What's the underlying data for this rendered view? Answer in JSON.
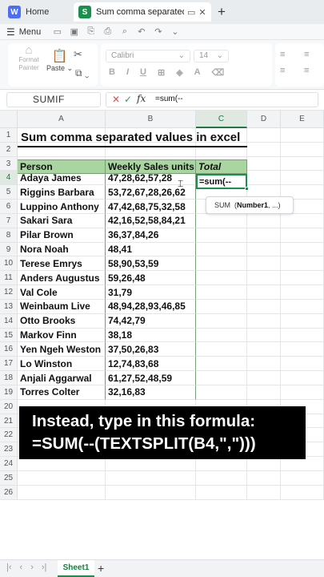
{
  "tabs": {
    "home": "Home",
    "doc": "Sum comma separated values",
    "doc_icon": "S",
    "home_icon": "W",
    "new_tab": "+"
  },
  "menu": {
    "label": "Menu"
  },
  "ribbon": {
    "format_painter": "Format Painter",
    "paste": "Paste",
    "font": "Calibri",
    "size": "14",
    "bold": "B",
    "italic": "I",
    "underline": "U"
  },
  "formula_bar": {
    "name_box": "SUMIF",
    "fx": "fx",
    "formula": "=sum(--"
  },
  "columns": [
    "A",
    "B",
    "C",
    "D",
    "E"
  ],
  "rows": [
    "1",
    "2",
    "3",
    "4",
    "5",
    "6",
    "7",
    "8",
    "9",
    "10",
    "11",
    "12",
    "13",
    "14",
    "15",
    "16",
    "17",
    "18",
    "19",
    "20",
    "21",
    "22",
    "23",
    "24",
    "25",
    "26"
  ],
  "sheet": {
    "title": "Sum comma separated values in excel",
    "headers": {
      "person": "Person",
      "sales": "Weekly Sales units",
      "total": "Total"
    },
    "data": [
      {
        "person": "Adaya James",
        "sales": "47,28,62,57,28"
      },
      {
        "person": "Riggins Barbara",
        "sales": "53,72,67,28,26,62"
      },
      {
        "person": "Luppino Anthony",
        "sales": "47,42,68,75,32,58"
      },
      {
        "person": "Sakari Sara",
        "sales": "42,16,52,58,84,21"
      },
      {
        "person": "Pilar Brown",
        "sales": "36,37,84,26"
      },
      {
        "person": "Nora Noah",
        "sales": "48,41"
      },
      {
        "person": "Terese Emrys",
        "sales": "58,90,53,59"
      },
      {
        "person": "Anders Augustus",
        "sales": "59,26,48"
      },
      {
        "person": "Val Cole",
        "sales": "31,79"
      },
      {
        "person": "Weinbaum Live",
        "sales": "48,94,28,93,46,85"
      },
      {
        "person": "Otto Brooks",
        "sales": "74,42,79"
      },
      {
        "person": "Markov Finn",
        "sales": "38,18"
      },
      {
        "person": "Yen Ngeh Weston",
        "sales": "37,50,26,83"
      },
      {
        "person": "Lo Winston",
        "sales": "12,74,83,68"
      },
      {
        "person": "Anjali Aggarwal",
        "sales": "61,27,52,48,59"
      },
      {
        "person": "Torres Colter",
        "sales": "32,16,83"
      }
    ],
    "active_cell_text": "=sum(--"
  },
  "tooltip": {
    "fn": "SUM",
    "arg": "Number1",
    "rest": ", ...)"
  },
  "banner": {
    "line1": "Instead, type in this formula:",
    "line2": "=SUM(--(TEXTSPLIT(B4,\",\")))"
  },
  "sheet_tab": {
    "name": "Sheet1",
    "add": "+"
  }
}
